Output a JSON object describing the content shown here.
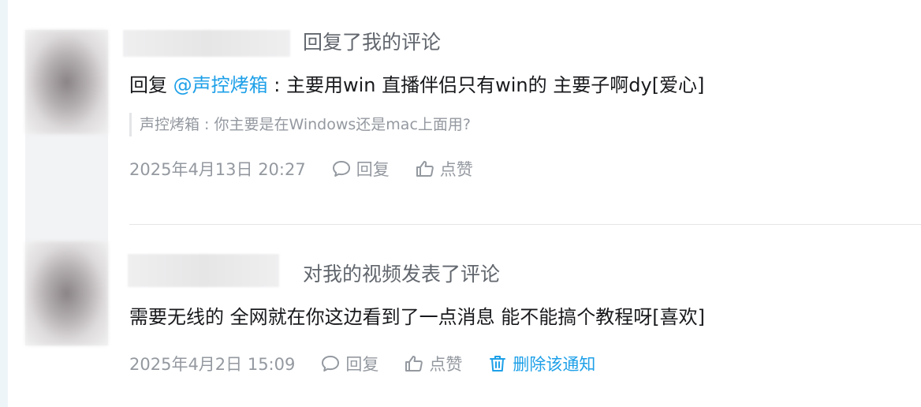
{
  "notifications": [
    {
      "action": "回复了我的评论",
      "reply_prefix": "回复",
      "mention": "@声控烤箱",
      "content": " : 主要用win 直播伴侣只有win的 主要子啊dy[爱心]",
      "quote": "声控烤箱 : 你主要是在Windows还是mac上面用?",
      "time": "2025年4月13日 20:27",
      "reply_label": "回复",
      "like_label": "点赞"
    },
    {
      "action": "对我的视频发表了评论",
      "content": "需要无线的 全网就在你这边看到了一点消息 能不能搞个教程呀[喜欢]",
      "time": "2025年4月2日 15:09",
      "reply_label": "回复",
      "like_label": "点赞",
      "delete_label": "删除该通知"
    }
  ],
  "colors": {
    "accent": "#1ea0e8",
    "muted": "#9499a0",
    "text": "#18191c"
  }
}
